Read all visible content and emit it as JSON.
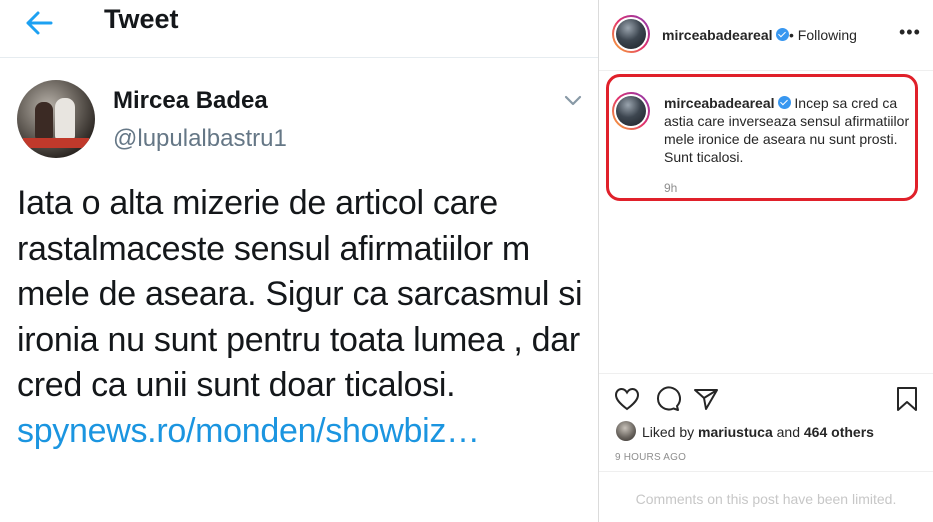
{
  "tweet": {
    "header_title": "Tweet",
    "author_name": "Mircea Badea",
    "author_handle": "@lupulalbastru1",
    "text": "Iata o alta mizerie de articol care rastalmaceste sensul afirmatiilor m mele de aseara. Sigur ca sarcasmul si ironia nu sunt pentru toata lumea , dar cred ca unii sunt doar ticalosi.",
    "link_text": "spynews.ro/monden/showbiz…",
    "link_color": "#1b95e0"
  },
  "instagram": {
    "header": {
      "username": "mirceabadeareal",
      "following_label": "• Following",
      "more_label": "•••"
    },
    "comment": {
      "username": "mirceabadeareal",
      "text": "Incep sa cred ca astia care inverseaza sensul afirmatiilor mele ironice de aseara nu sunt prosti. Sunt ticalosi.",
      "time": "9h"
    },
    "likes": {
      "prefix": "Liked by",
      "user": "mariustuca",
      "conjunction": "and",
      "others": "464 others"
    },
    "time_ago": "9 HOURS AGO",
    "comments_limited": "Comments on this post have been limited.",
    "highlight_color": "#e0202a"
  },
  "icons": [
    "back-arrow-icon",
    "chevron-down-icon",
    "verified-icon",
    "more-icon",
    "heart-icon",
    "comment-icon",
    "share-icon",
    "bookmark-icon"
  ]
}
